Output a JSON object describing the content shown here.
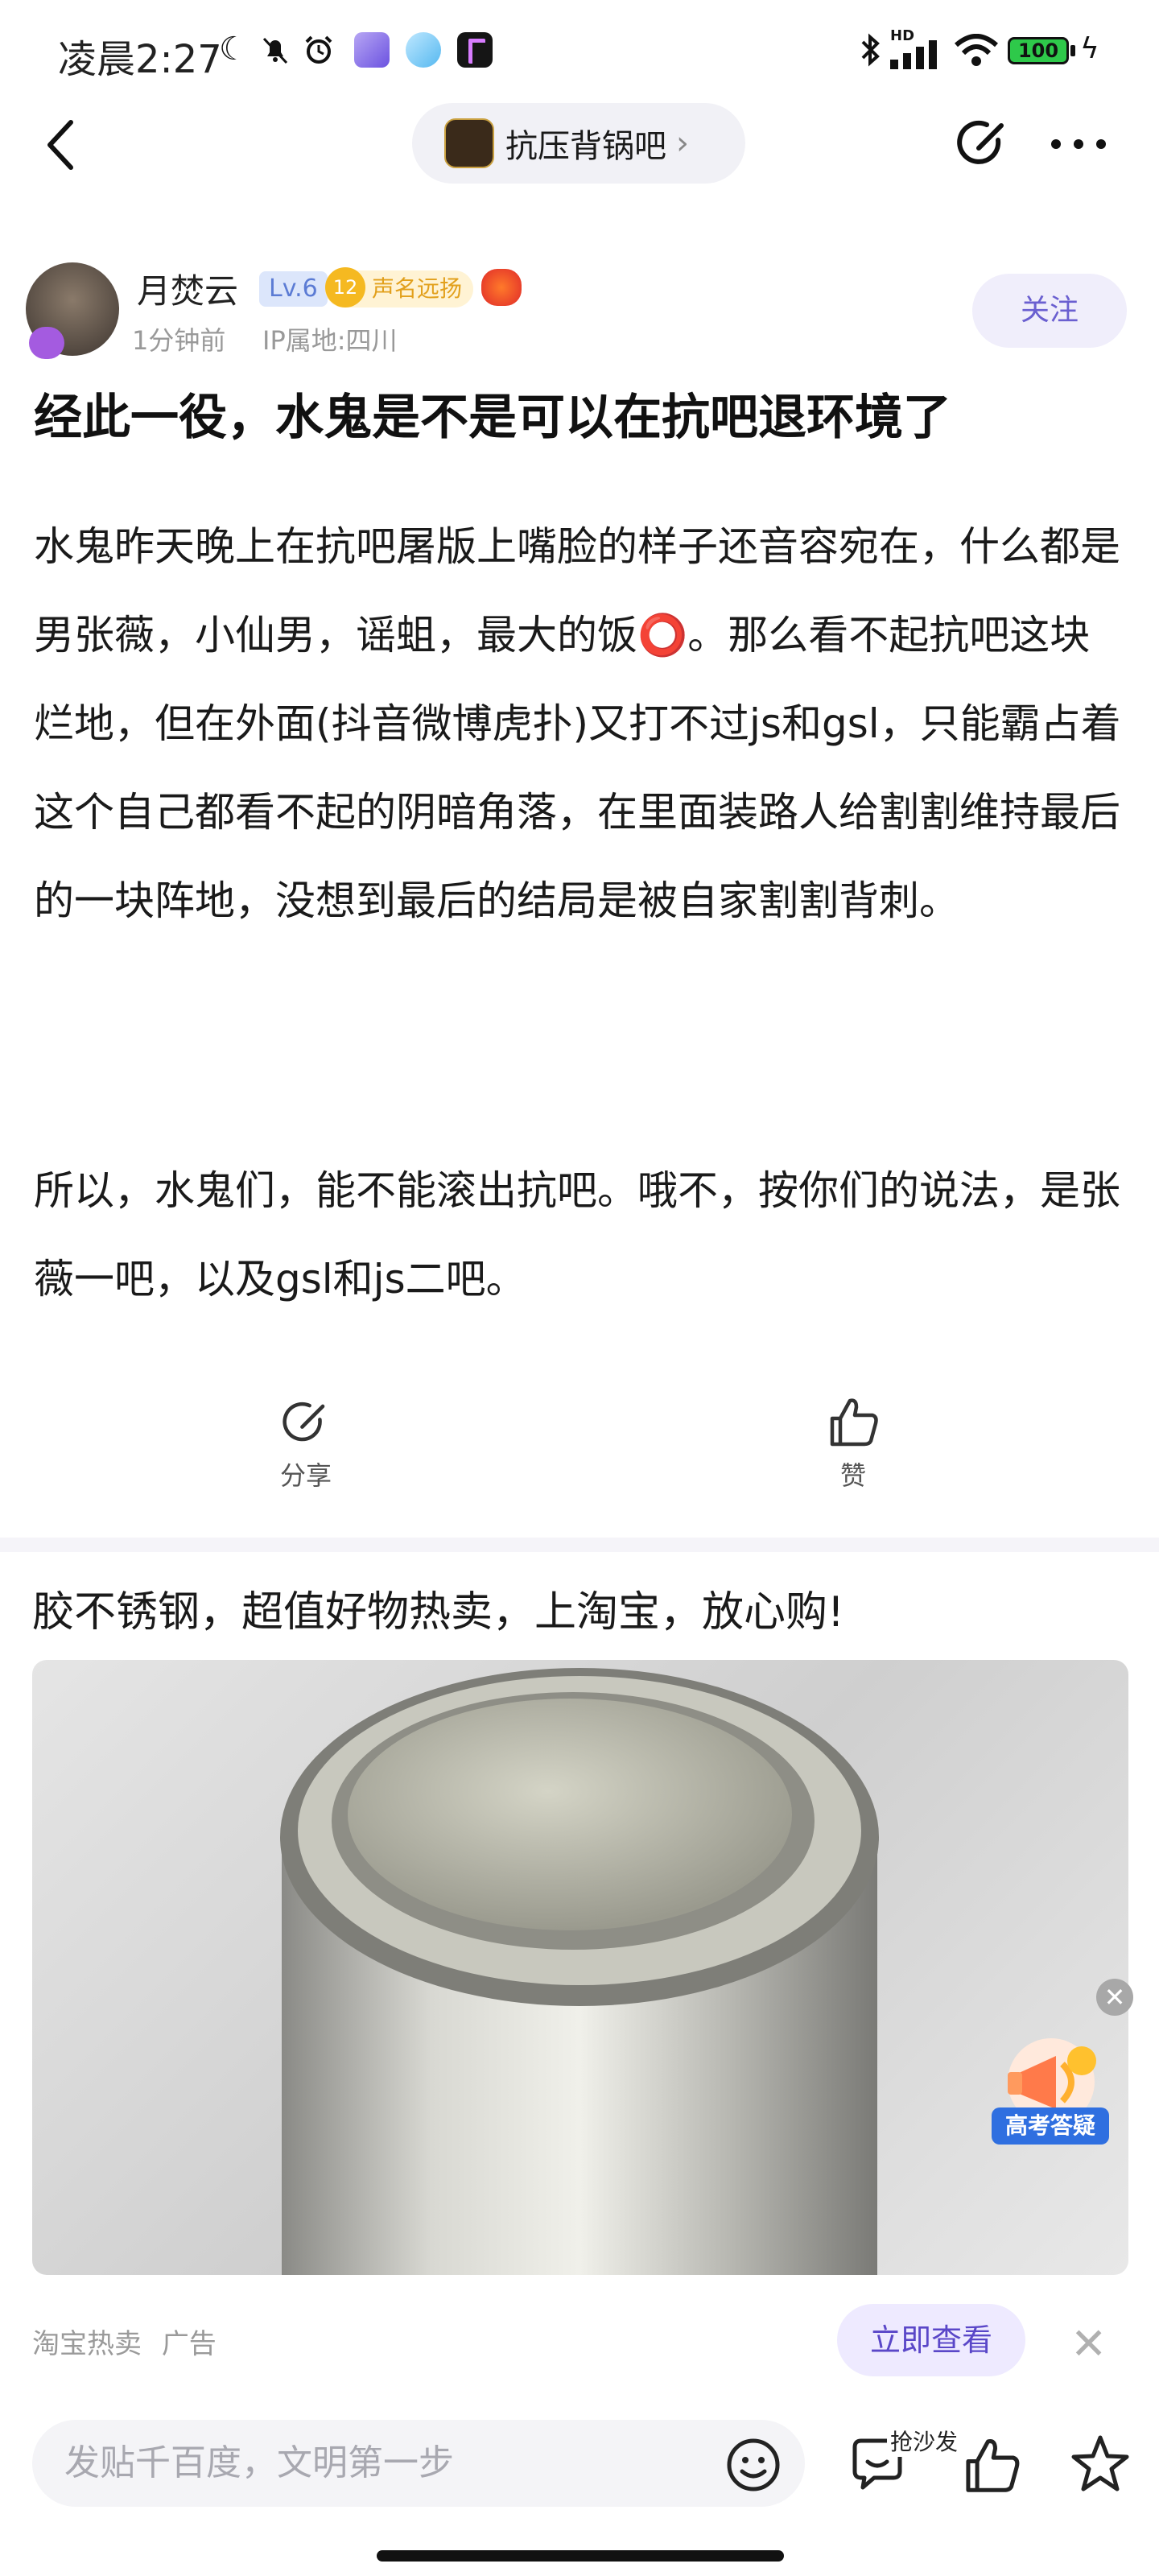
{
  "status_bar": {
    "time": "凌晨2:27",
    "hd_label": "HD",
    "battery": "100"
  },
  "nav": {
    "forum_name": "抗压背锅吧",
    "forum_chevron": "›"
  },
  "author": {
    "name": "月焚云",
    "level": "Lv.6",
    "reputation_level": "12",
    "reputation_title": "声名远扬",
    "time": "1分钟前",
    "ip": "IP属地:四川",
    "follow_label": "关注"
  },
  "post": {
    "title": "经此一役，水鬼是不是可以在抗吧退环境了",
    "paragraphs": [
      "水鬼昨天晚上在抗吧屠版上嘴脸的样子还音容宛在，什么都是男张薇，小仙男，谣蛆，最大的饭⭕️。那么看不起抗吧这块烂地，但在外面(抖音微博虎扑)又打不过js和gsl，只能霸占着这个自己都看不起的阴暗角落，在里面装路人给割割维持最后的一块阵地，没想到最后的结局是被自家割割背刺。",
      "所以，水鬼们，能不能滚出抗吧。哦不，按你们的说法，是张薇一吧，以及gsl和js二吧。"
    ]
  },
  "actions": {
    "share_label": "分享",
    "like_label": "赞"
  },
  "ad": {
    "title": "胶不锈钢，超值好物热卖，上淘宝，放心购!",
    "source": "淘宝热卖",
    "tag": "广告",
    "cta_label": "立即查看",
    "close": "✕"
  },
  "floating_promo": {
    "label": "高考答疑",
    "close": "✕"
  },
  "bottom_bar": {
    "input_placeholder": "发贴千百度，文明第一步",
    "sofa_label": "抢沙发"
  },
  "colors": {
    "accent": "#6a5fd0",
    "level_badge": "#5b7bd4",
    "reputation": "#f5b921",
    "promo_blue": "#2f6fe0"
  }
}
